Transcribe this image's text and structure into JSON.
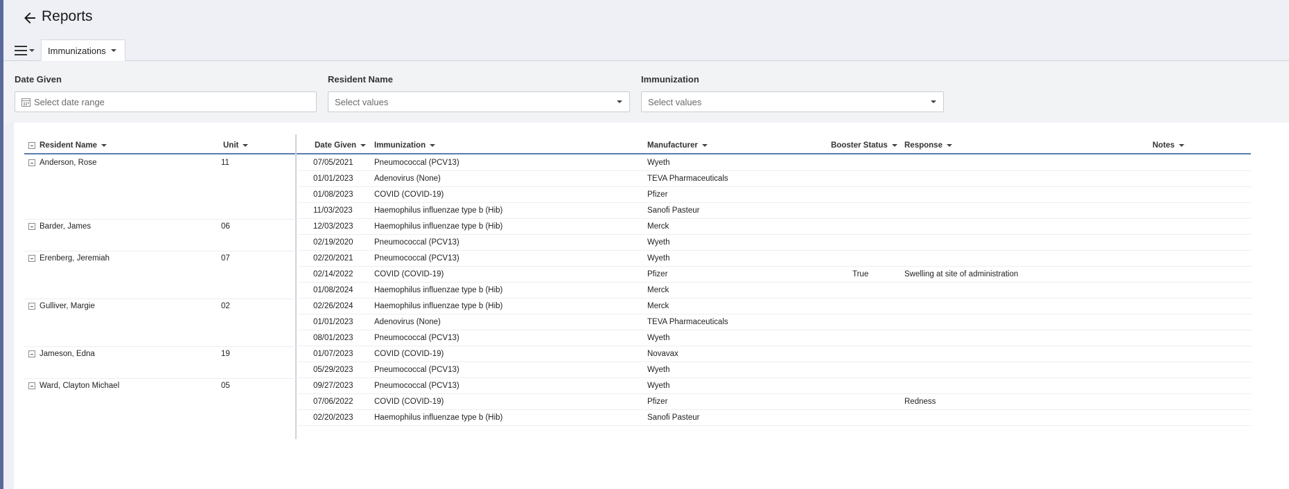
{
  "header": {
    "title": "Reports"
  },
  "toolbar": {
    "view_tab_label": "Immunizations"
  },
  "filters": {
    "date_given": {
      "label": "Date Given",
      "placeholder": "Select date range"
    },
    "resident_name": {
      "label": "Resident Name",
      "placeholder": "Select values"
    },
    "immunization": {
      "label": "Immunization",
      "placeholder": "Select values"
    }
  },
  "grid": {
    "columns": {
      "resident_name": "Resident Name",
      "unit": "Unit",
      "date_given": "Date Given",
      "immunization": "Immunization",
      "manufacturer": "Manufacturer",
      "booster_status": "Booster Status",
      "response": "Response",
      "notes": "Notes"
    },
    "groups": [
      {
        "name": "Anderson, Rose",
        "unit": "11"
      },
      {
        "name": "Barder, James",
        "unit": "06"
      },
      {
        "name": "Erenberg, Jeremiah",
        "unit": "07"
      },
      {
        "name": "Gulliver, Margie",
        "unit": "02"
      },
      {
        "name": "Jameson, Edna",
        "unit": "19"
      },
      {
        "name": "Ward, Clayton Michael",
        "unit": "05"
      }
    ],
    "rows": [
      {
        "date": "07/05/2021",
        "immunization": "Pneumococcal (PCV13)",
        "manufacturer": "Wyeth",
        "booster": "",
        "response": "",
        "notes": ""
      },
      {
        "date": "01/01/2023",
        "immunization": "Adenovirus (None)",
        "manufacturer": "TEVA Pharmaceuticals",
        "booster": "",
        "response": "",
        "notes": ""
      },
      {
        "date": "01/08/2023",
        "immunization": "COVID (COVID-19)",
        "manufacturer": "Pfizer",
        "booster": "",
        "response": "",
        "notes": ""
      },
      {
        "date": "11/03/2023",
        "immunization": "Haemophilus influenzae type b (Hib)",
        "manufacturer": "Sanofi Pasteur",
        "booster": "",
        "response": "",
        "notes": ""
      },
      {
        "date": "12/03/2023",
        "immunization": "Haemophilus influenzae type b (Hib)",
        "manufacturer": "Merck",
        "booster": "",
        "response": "",
        "notes": ""
      },
      {
        "date": "02/19/2020",
        "immunization": "Pneumococcal (PCV13)",
        "manufacturer": "Wyeth",
        "booster": "",
        "response": "",
        "notes": ""
      },
      {
        "date": "02/20/2021",
        "immunization": "Pneumococcal (PCV13)",
        "manufacturer": "Wyeth",
        "booster": "",
        "response": "",
        "notes": ""
      },
      {
        "date": "02/14/2022",
        "immunization": "COVID (COVID-19)",
        "manufacturer": "Pfizer",
        "booster": "True",
        "response": "Swelling at site of administration",
        "notes": ""
      },
      {
        "date": "01/08/2024",
        "immunization": "Haemophilus influenzae type b (Hib)",
        "manufacturer": "Merck",
        "booster": "",
        "response": "",
        "notes": ""
      },
      {
        "date": "02/26/2024",
        "immunization": "Haemophilus influenzae type b (Hib)",
        "manufacturer": "Merck",
        "booster": "",
        "response": "",
        "notes": ""
      },
      {
        "date": "01/01/2023",
        "immunization": "Adenovirus (None)",
        "manufacturer": "TEVA Pharmaceuticals",
        "booster": "",
        "response": "",
        "notes": ""
      },
      {
        "date": "08/01/2023",
        "immunization": "Pneumococcal (PCV13)",
        "manufacturer": "Wyeth",
        "booster": "",
        "response": "",
        "notes": ""
      },
      {
        "date": "01/07/2023",
        "immunization": "COVID (COVID-19)",
        "manufacturer": "Novavax",
        "booster": "",
        "response": "",
        "notes": ""
      },
      {
        "date": "05/29/2023",
        "immunization": "Pneumococcal (PCV13)",
        "manufacturer": "Wyeth",
        "booster": "",
        "response": "",
        "notes": ""
      },
      {
        "date": "09/27/2023",
        "immunization": "Pneumococcal (PCV13)",
        "manufacturer": "Wyeth",
        "booster": "",
        "response": "",
        "notes": ""
      },
      {
        "date": "07/06/2022",
        "immunization": "COVID (COVID-19)",
        "manufacturer": "Pfizer",
        "booster": "",
        "response": "Redness",
        "notes": ""
      },
      {
        "date": "02/20/2023",
        "immunization": "Haemophilus influenzae type b (Hib)",
        "manufacturer": "Sanofi Pasteur",
        "booster": "",
        "response": "",
        "notes": ""
      }
    ]
  }
}
